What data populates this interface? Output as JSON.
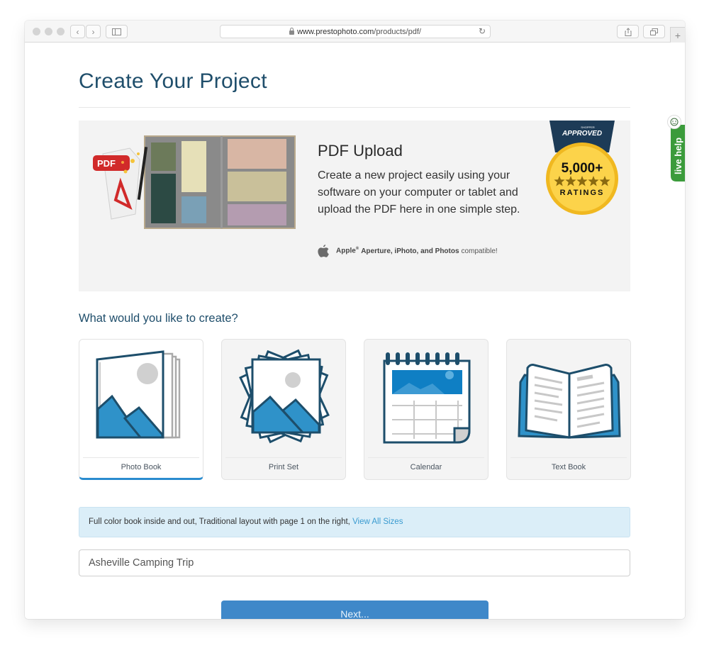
{
  "browser": {
    "url_domain": "www.prestophoto.com",
    "url_path": "/products/pdf/",
    "back_icon": "chevron-left-icon",
    "forward_icon": "chevron-right-icon",
    "sidebar_icon": "sidebar-icon",
    "reload_icon": "reload-icon",
    "share_icon": "share-icon",
    "tabs_icon": "tabs-overview-icon",
    "new_tab_label": "+"
  },
  "page": {
    "title": "Create Your Project"
  },
  "hero": {
    "heading": "PDF Upload",
    "description": "Create a new project easily using your software on your computer or tablet and upload the PDF here in one simple step.",
    "compat_apple": "Apple",
    "compat_reg": "®",
    "compat_products": "Aperture, iPhoto, and Photos",
    "compat_suffix": "compatible!",
    "badge": {
      "brand": "SHOPPER APPROVED",
      "count": "5,000+",
      "stars": 5,
      "label": "RATINGS"
    }
  },
  "live_help": {
    "label": "live help"
  },
  "create": {
    "question": "What would you like to create?",
    "options": [
      {
        "label": "Photo Book",
        "icon": "photo-book-icon",
        "selected": true
      },
      {
        "label": "Print Set",
        "icon": "print-set-icon",
        "selected": false
      },
      {
        "label": "Calendar",
        "icon": "calendar-icon",
        "selected": false
      },
      {
        "label": "Text Book",
        "icon": "text-book-icon",
        "selected": false
      }
    ]
  },
  "info": {
    "text": "Full color book inside and out, Traditional layout with page 1 on the right, ",
    "link": "View All Sizes"
  },
  "project_name": {
    "value": "Asheville Camping Trip"
  },
  "next_button": {
    "label": "Next..."
  },
  "colors": {
    "heading": "#1f4e6b",
    "accent": "#2a8ccf",
    "button": "#3f88c9",
    "info_bg": "#dbeef8",
    "live_help": "#3b9b3b"
  }
}
